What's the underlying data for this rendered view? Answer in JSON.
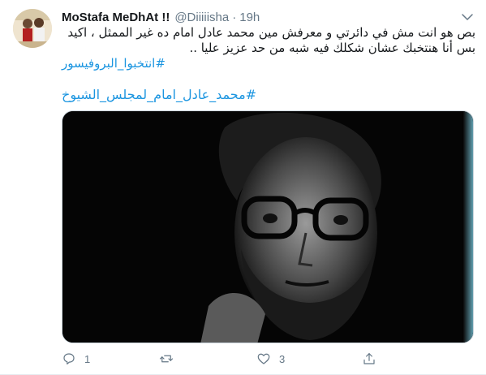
{
  "tweet": {
    "display_name": "MoStafa MeDhAt !!",
    "handle": "@Diiiiisha",
    "separator": "·",
    "time": "19h",
    "text_line1": "بص هو انت مش في دائرتي و معرفش مين محمد عادل امام ده غير الممثل ، اكيد",
    "text_line2": "بس أنا هنتخبك عشان شكلك فيه شبه من حد عزيز عليا ..",
    "hashtag1": "#انتخبوا_البروفيسور",
    "hashtag2": "#محمد_عادل_امام_لمجلس_الشيوخ"
  },
  "actions": {
    "reply_count": "1",
    "retweet_count": "",
    "like_count": "3"
  },
  "icons": {
    "caret": "chevron-down-icon",
    "reply": "reply-icon",
    "retweet": "retweet-icon",
    "like": "heart-icon",
    "share": "share-icon"
  },
  "colors": {
    "link": "#1b95e0",
    "muted": "#657786",
    "text": "#14171a"
  }
}
